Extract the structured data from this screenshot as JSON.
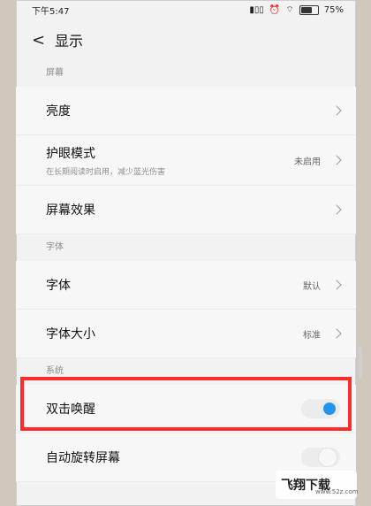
{
  "status_bar": {
    "time": "下午5:47",
    "battery": "75%",
    "battery_level": 0.75
  },
  "header": {
    "back_icon": "<",
    "title": "显示"
  },
  "sections": [
    {
      "label": "屏幕",
      "items": [
        {
          "title": "亮度",
          "subtitle": "",
          "value": ""
        },
        {
          "title": "护眼模式",
          "subtitle": "在长期阅读时启用，减少蓝光伤害",
          "value": "未启用"
        },
        {
          "title": "屏幕效果",
          "subtitle": "",
          "value": ""
        }
      ]
    },
    {
      "label": "字体",
      "items": [
        {
          "title": "字体",
          "subtitle": "",
          "value": "默认"
        },
        {
          "title": "字体大小",
          "subtitle": "",
          "value": "标准"
        }
      ]
    },
    {
      "label": "系统",
      "items": [
        {
          "title": "双击唤醒",
          "subtitle": "",
          "value": "",
          "toggle": "on"
        },
        {
          "title": "自动旋转屏幕",
          "subtitle": "",
          "value": "",
          "toggle": "off"
        }
      ]
    }
  ],
  "watermark": {
    "text": "飞翔下载",
    "url": "www.52z.com"
  },
  "colors": {
    "accent": "#2794ea",
    "highlight": "#ff2a2a"
  }
}
